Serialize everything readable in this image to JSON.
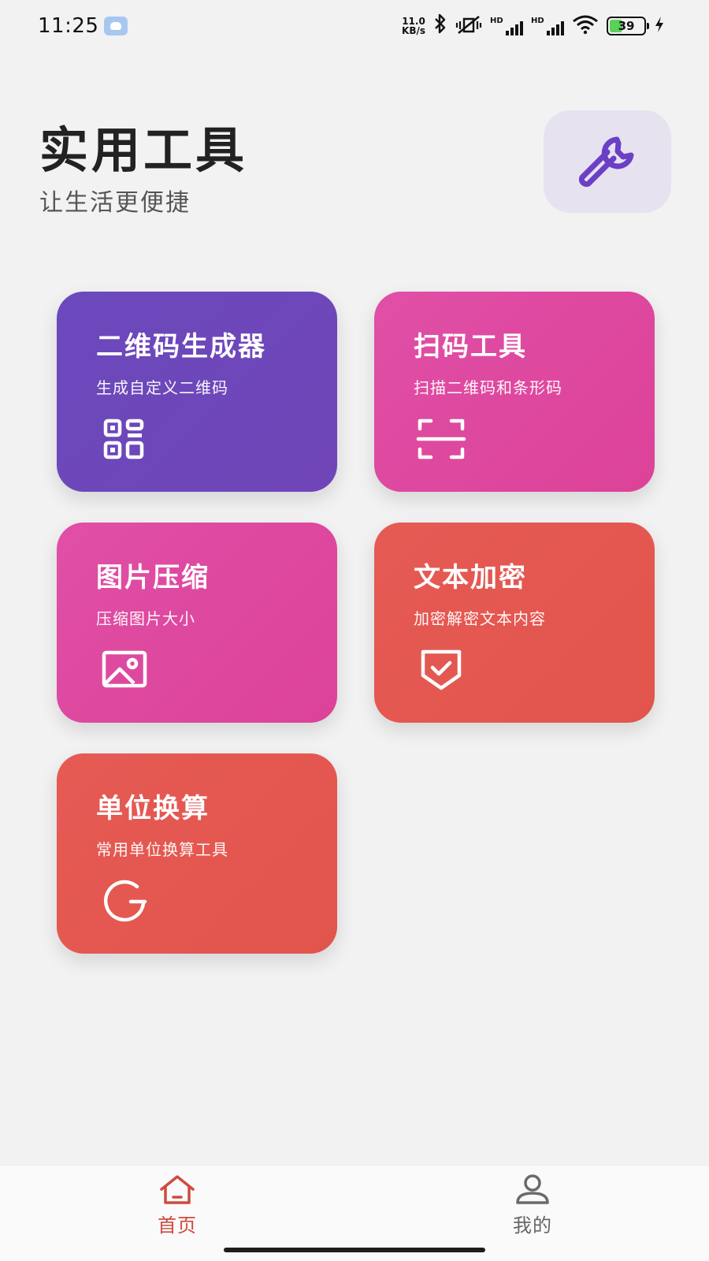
{
  "status_bar": {
    "time": "11:25",
    "net_speed_value": "11.0",
    "net_speed_unit": "KB/s",
    "battery": "39",
    "battery_level": 0.39,
    "signal_label_1": "HD",
    "signal_label_2": "HD"
  },
  "header": {
    "title": "实用工具",
    "subtitle": "让生活更便捷",
    "badge_icon": "wrench-icon"
  },
  "tools": [
    {
      "title": "二维码生成器",
      "desc": "生成自定义二维码",
      "icon": "qr-code-icon",
      "color": "#6b49bd"
    },
    {
      "title": "扫码工具",
      "desc": "扫描二维码和条形码",
      "icon": "scan-icon",
      "color": "#e04fa6"
    },
    {
      "title": "图片压缩",
      "desc": "压缩图片大小",
      "icon": "image-icon",
      "color": "#e04fa6"
    },
    {
      "title": "文本加密",
      "desc": "加密解密文本内容",
      "icon": "shield-check-icon",
      "color": "#e65a55"
    },
    {
      "title": "单位换算",
      "desc": "常用单位换算工具",
      "icon": "refresh-icon",
      "color": "#e65a55"
    }
  ],
  "bottom_nav": [
    {
      "label": "首页",
      "icon": "home-icon",
      "active": true,
      "color": "#d04a3f"
    },
    {
      "label": "我的",
      "icon": "user-icon",
      "active": false,
      "color": "#666666"
    }
  ]
}
